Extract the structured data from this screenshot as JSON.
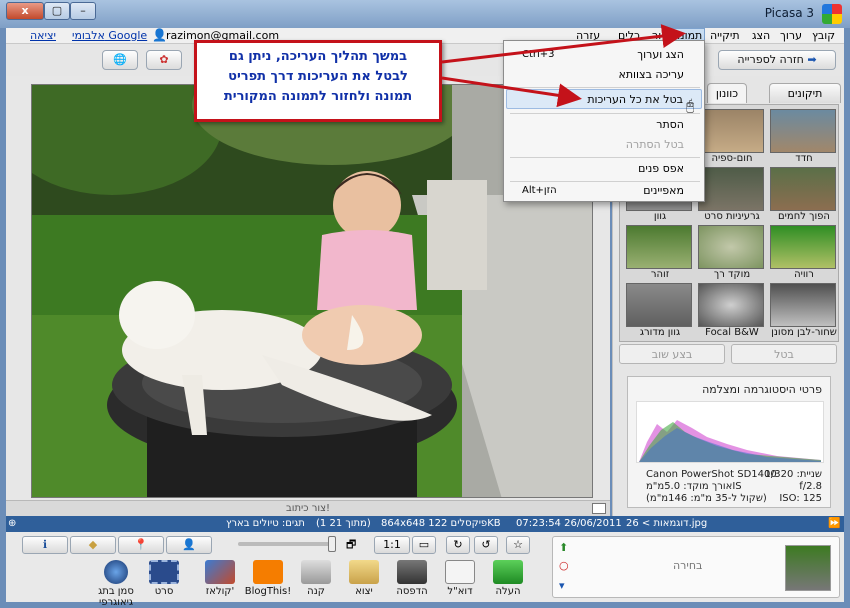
{
  "window": {
    "title": "Picasa 3",
    "close": "x"
  },
  "menubar": {
    "items": [
      "קובץ",
      "ערוך",
      "הצג",
      "תיקייה",
      "תמונה",
      "יצירה",
      "כלים",
      "עזרה"
    ],
    "visible_items": [
      "קובץ",
      "ערוך",
      "הצג",
      "תיקייה",
      "תמונה",
      "ור",
      "כלים",
      "עזרה"
    ],
    "user_links": {
      "exit": "יציאה",
      "albums": "אלבומי Google",
      "email": "razimon@gmail.com"
    }
  },
  "toolbar": {
    "back_to_library": "חזרה לספרייה"
  },
  "context_menu": {
    "items": [
      {
        "label": "הצג וערוך",
        "shortcut": "Ctrl+3",
        "enabled": true
      },
      {
        "label": "עריכה בצוותא",
        "shortcut": "",
        "enabled": true
      },
      {
        "label": "בטל את כל העריכות",
        "shortcut": "",
        "enabled": true,
        "highlighted": true
      },
      {
        "label": "הסתר",
        "shortcut": "",
        "enabled": true
      },
      {
        "label": "בטל הסתרה",
        "shortcut": "",
        "enabled": false
      },
      {
        "label": "אפס פנים",
        "shortcut": "",
        "enabled": true
      },
      {
        "label": "מאפיינים",
        "shortcut": "Alt+הזן",
        "enabled": true
      }
    ]
  },
  "callout": {
    "lines": [
      "במשך תהליך העריכה, ניתן גם",
      "לבטל את העריכות דרך תפריט",
      "תמונה ולחזור לתמונה המקורית"
    ],
    "color": "#c4121a"
  },
  "panel": {
    "tabs": [
      "תיקונים בסיסיים",
      "כוונון"
    ],
    "effects": [
      "חדד",
      "חום-ספיה",
      "הפוך לחמים יותר",
      "גרעיניות סרט",
      "גוון",
      "רוויה",
      "מוקד רך",
      "זוהר",
      "שחור-לבן מסונן",
      "Focal B&W",
      "גוון מדורג"
    ],
    "undo": "בטל",
    "redo": "בצע שוב",
    "histogram_title": "פרטי היסטוגרמה ומצלמה",
    "camera": {
      "shutter": "1/320 :שניית",
      "fstop": "f/2.8",
      "iso": "ISO: 125",
      "model": "Canon PowerShot SD1400",
      "focal": "אורך מוקד: 5.0מ\"מIS",
      "equiv": "(שקול ל-35 מ\"מ: 146מ\"מ)"
    }
  },
  "caption": {
    "placeholder": "צור כיתוב!"
  },
  "statusbar": {
    "path": "דוגמאות > 26.jpg",
    "date": "07:23:54 26/06/2011",
    "dims": "864x648 פיקסלים 122KB",
    "index": "(1 מתוך 21)",
    "tags": "תגים: טיולים בארץ"
  },
  "tray": {
    "selection_label": "בחירה",
    "actions": [
      "העלה",
      "דוא\"ל",
      "הדפסה",
      "יצוא",
      "קנה",
      "BlogThis!",
      "קולאז'",
      "סרט",
      "סמן בתג גיאוגרפי"
    ],
    "view_buttons": [
      "1:1"
    ]
  },
  "colors": {
    "accent": "#2f5f9a",
    "callout_border": "#c4121a",
    "callout_text": "#1030a8"
  }
}
